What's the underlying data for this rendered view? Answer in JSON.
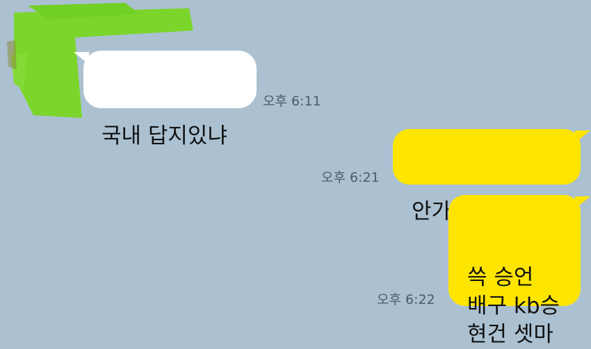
{
  "messages": [
    {
      "direction": "incoming",
      "text": "국내 답지있냐",
      "time": "오후 6:11"
    },
    {
      "direction": "outgoing",
      "text": "안가실거잖아요",
      "time": "오후 6:21"
    },
    {
      "direction": "outgoing",
      "text": "쓱 승언\n배구 kb승\n현건 셋마",
      "time": "오후 6:22"
    }
  ],
  "colors": {
    "background": "#abc1d1",
    "incoming_bubble": "#ffffff",
    "outgoing_bubble": "#fee500",
    "redaction_scribble": "#7bd52b"
  }
}
